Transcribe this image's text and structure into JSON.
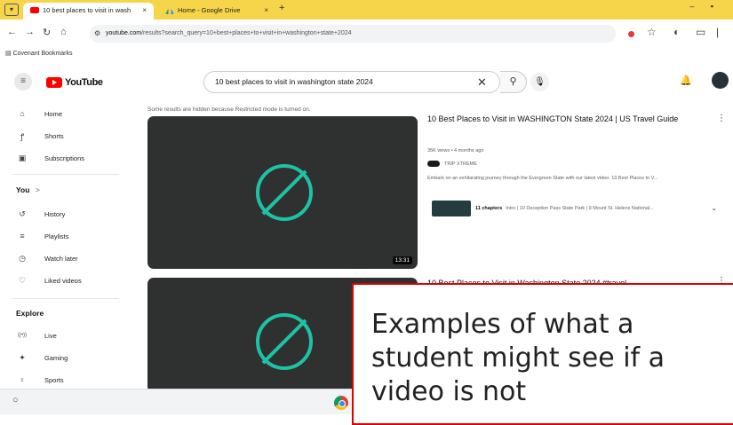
{
  "browser": {
    "tabs": [
      {
        "title": "10 best places to visit in wash",
        "close": "×"
      },
      {
        "title": "Home - Google Drive",
        "close": "×"
      }
    ],
    "new_tab": "+",
    "window_controls": "– ▪",
    "url_host": "youtube.com",
    "url_path": "/results?search_query=10+best+places+to+visit+in+washington+state+2024",
    "bookmark": "Covenant Bookmarks"
  },
  "header": {
    "logo_text": "YouTube",
    "search_value": "10 best places to visit in washington state 2024",
    "clear": "✕",
    "search_icon": "magnifier-icon"
  },
  "sidebar": {
    "items_top": [
      {
        "icon": "⌂",
        "label": "Home"
      },
      {
        "icon": "ꝭ",
        "label": "Shorts"
      },
      {
        "icon": "▣",
        "label": "Subscriptions"
      }
    ],
    "you_heading": "You",
    "you_arrow": ">",
    "items_you": [
      {
        "icon": "↺",
        "label": "History"
      },
      {
        "icon": "≡",
        "label": "Playlists"
      },
      {
        "icon": "◷",
        "label": "Watch later"
      },
      {
        "icon": "♡",
        "label": "Liked videos"
      }
    ],
    "explore_heading": "Explore",
    "items_explore": [
      {
        "icon": "((•))",
        "label": "Live"
      },
      {
        "icon": "✦",
        "label": "Gaming"
      },
      {
        "icon": "♀",
        "label": "Sports"
      }
    ]
  },
  "results": {
    "notice": "Some results are hidden because Restricted mode is turned on.",
    "videos": [
      {
        "title": "10 Best Places to Visit in WASHINGTON State 2024 | US Travel Guide",
        "meta": "35K views • 4 months ago",
        "channel": "TRIP XTREME",
        "description": "Embark on an exhilarating journey through the Evergreen State with our latest video: 10 Best Places to V...",
        "chapters_count": "11 chapters",
        "chapters_text": "Intro | 10 Deception Pass State Park | 9 Mount St. Helens National...",
        "duration": "13:31"
      },
      {
        "title": "10 Best Places to Visit in Washington State 2024 #travel"
      }
    ]
  },
  "overlay": {
    "line1": "Examples of what a",
    "line2": "student might see if a",
    "line3": "video is not"
  },
  "colors": {
    "accent": "#ff0000",
    "blocked_icon": "#1ec3a3",
    "overlay_border": "#e00000"
  }
}
